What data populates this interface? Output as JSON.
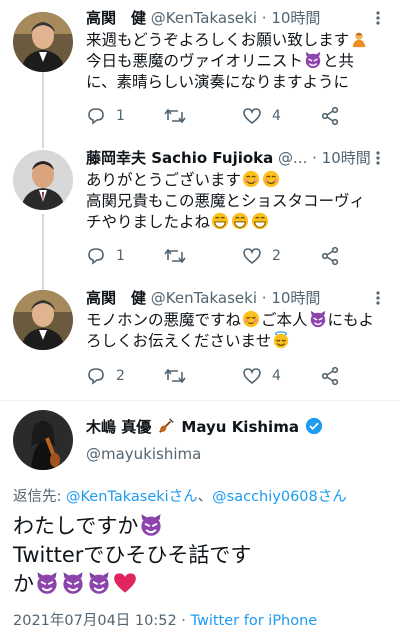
{
  "tweets": [
    {
      "name": "高関　健",
      "handle": "@KenTakaseki",
      "time": "· 10時間",
      "lines": [
        "来週もどうぞよろしくお願い致します",
        "今日も悪魔のヴァイオリニスト",
        "と共",
        "に、素晴らしい演奏になりますように"
      ],
      "replies": "1",
      "likes": "4"
    },
    {
      "name": "藤岡幸夫 Sachio Fujioka",
      "handle": "@...",
      "time": "· 10時間",
      "lines": [
        "ありがとうございます",
        "高関兄貴もこの悪魔とショスタコーヴィ",
        "チやりましたよね"
      ],
      "replies": "1",
      "likes": "2"
    },
    {
      "name": "高関　健",
      "handle": "@KenTakaseki",
      "time": "· 10時間",
      "lines": [
        "モノホンの悪魔ですね",
        "ご本人",
        "にもよ",
        "ろしくお伝えくださいませ"
      ],
      "replies": "2",
      "likes": "4"
    }
  ],
  "main": {
    "name": "木嶋 真優",
    "name_suffix": "Mayu Kishima",
    "handle": "@mayukishima",
    "reply_prefix": "返信先: ",
    "reply_link1": "@KenTakasekiさん",
    "reply_sep": "、",
    "reply_link2": "@sacchiy0608さん",
    "text_line1": "わたしですか",
    "text_line2": "Twitterでひそひそ話です",
    "text_line3": "か",
    "date": "2021年07月04日 10:52 · ",
    "via": "Twitter for iPhone"
  },
  "colors": {
    "accent": "#1d9bf0",
    "muted": "#536471",
    "devil": "#8e44ad",
    "heart": "#e0245e"
  }
}
